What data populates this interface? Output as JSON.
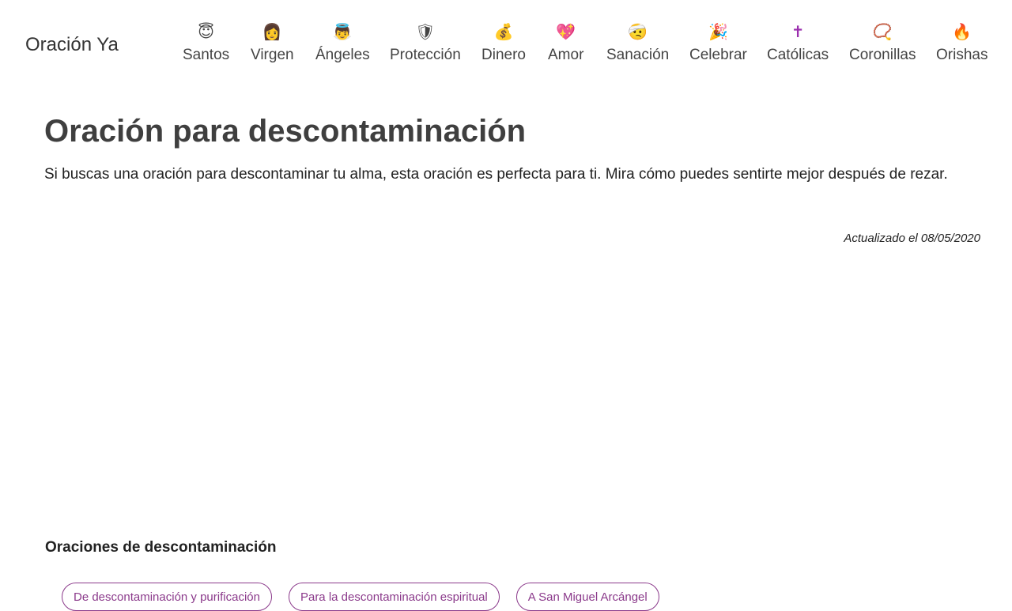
{
  "header": {
    "brand": "Oración Ya",
    "nav": [
      {
        "icon": "😇",
        "icon_name": "smiling-face-with-halo-icon",
        "label": "Santos"
      },
      {
        "icon": "👩",
        "icon_name": "woman-icon",
        "label": "Virgen"
      },
      {
        "icon": "👼",
        "icon_name": "baby-angel-icon",
        "label": "Ángeles"
      },
      {
        "icon": "🛡",
        "icon_name": "shield-icon",
        "label": "Protección"
      },
      {
        "icon": "💰",
        "icon_name": "money-bag-icon",
        "label": "Dinero"
      },
      {
        "icon": "💖",
        "icon_name": "sparkling-heart-icon",
        "label": "Amor"
      },
      {
        "icon": "🤕",
        "icon_name": "bandaged-face-icon",
        "label": "Sanación"
      },
      {
        "icon": "🎉",
        "icon_name": "party-popper-icon",
        "label": "Celebrar"
      },
      {
        "icon": "✝",
        "icon_name": "latin-cross-icon",
        "label": "Católicas"
      },
      {
        "icon": "📿",
        "icon_name": "rosary-beads-icon",
        "label": "Coronillas"
      },
      {
        "icon": "🔥",
        "icon_name": "fire-icon",
        "label": "Orishas"
      }
    ]
  },
  "article": {
    "title": "Oración para descontaminación",
    "intro": "Si buscas una oración para descontaminar tu alma, esta oración es perfecta para ti. Mira cómo puedes sentirte mejor después de rezar.",
    "updated": "Actualizado el 08/05/2020"
  },
  "related": {
    "heading": "Oraciones de descontaminación",
    "links": [
      "De descontaminación y purificación",
      "Para la descontaminación espiritual",
      "A San Miguel Arcángel"
    ]
  },
  "colors": {
    "accent": "#8b3a8b",
    "text": "#444444"
  }
}
